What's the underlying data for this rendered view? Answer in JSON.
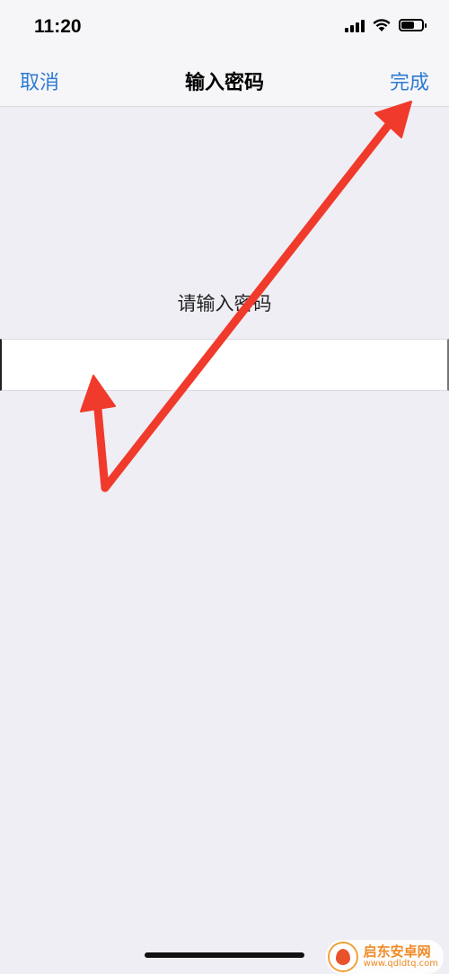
{
  "status_bar": {
    "time": "11:20",
    "battery_level": 0.7
  },
  "nav": {
    "cancel_label": "取消",
    "title": "输入密码",
    "done_label": "完成"
  },
  "prompt": {
    "text": "请输入密码"
  },
  "password_field": {
    "value": "",
    "placeholder": ""
  },
  "annotations": {
    "arrow_color": "#f03a2c"
  },
  "watermark": {
    "name": "启东安卓网",
    "domain": "www.qdldtq.com"
  },
  "colors": {
    "accent": "#2f7bd3",
    "background": "#efeef4"
  }
}
